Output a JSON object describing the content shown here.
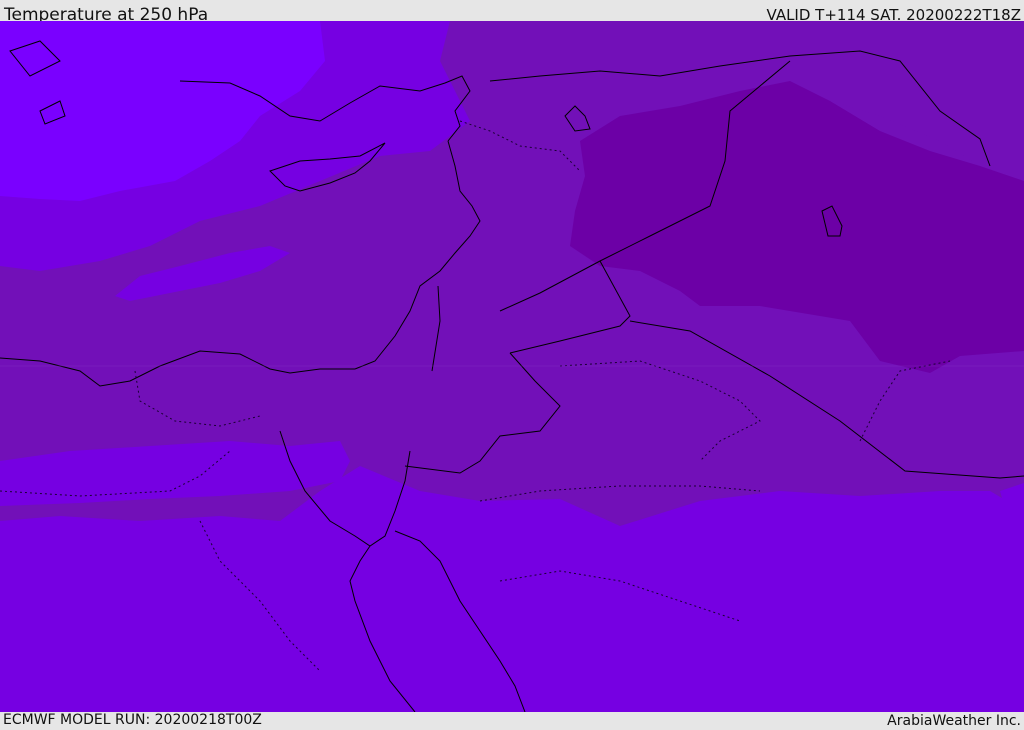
{
  "header": {
    "title": "Temperature at 250 hPa",
    "valid": "VALID T+114 SAT. 20200222T18Z"
  },
  "footer": {
    "model_run": "ECMWF MODEL RUN: 20200218T00Z",
    "credit": "ArabiaWeather Inc."
  },
  "colors": {
    "band_warmest": "#7a00ff",
    "band_warm": "#7600e2",
    "band_mid": "#7210b8",
    "band_cool": "#6c00a6",
    "coastline": "#000000",
    "frame_bg": "#e6e6e6"
  }
}
